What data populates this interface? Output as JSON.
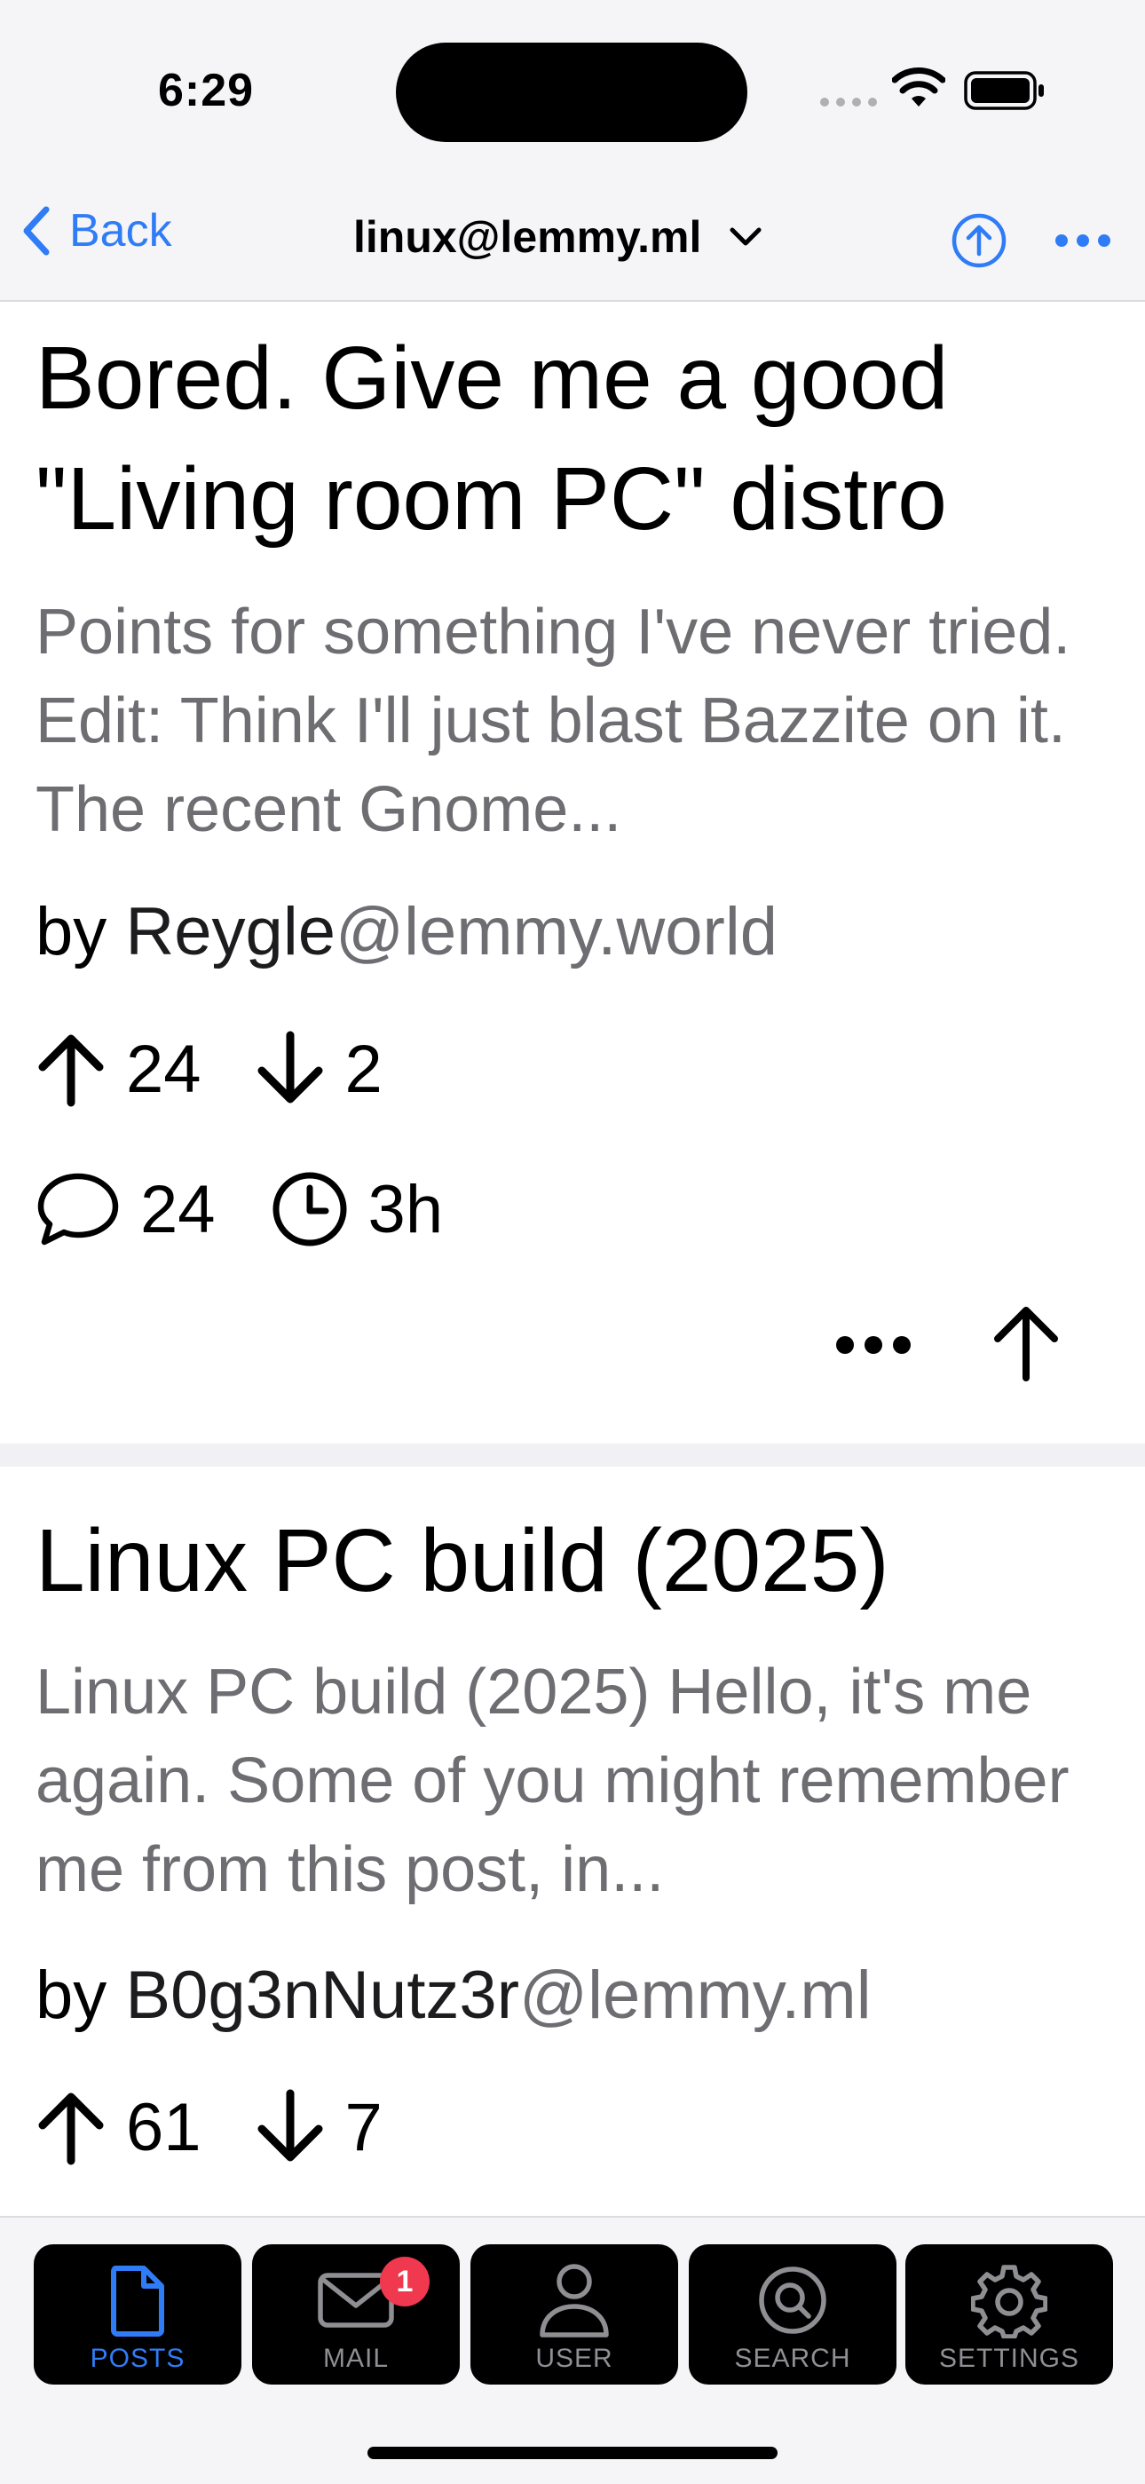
{
  "status": {
    "time": "6:29"
  },
  "nav": {
    "back_label": "Back",
    "title": "linux@lemmy.ml"
  },
  "posts": [
    {
      "title": "Bored. Give me a good \"Living room PC\" distro",
      "body": "Points for something I've never tried. Edit: Think I'll just blast Bazzite on it. The recent Gnome...",
      "by": "by",
      "author": "Reygle",
      "instance": "@lemmy.world",
      "upvotes": "24",
      "downvotes": "2",
      "comments": "24",
      "age": "3h"
    },
    {
      "title": "Linux PC build (2025)",
      "body": "Linux PC build (2025) Hello, it's me again. Some of you might remember me from this post, in...",
      "by": "by",
      "author": "B0g3nNutz3r",
      "instance": "@lemmy.ml",
      "upvotes": "61",
      "downvotes": "7"
    }
  ],
  "tabs": [
    {
      "label": "POSTS",
      "icon": "document-icon",
      "active": true
    },
    {
      "label": "MAIL",
      "icon": "envelope-icon",
      "badge": "1"
    },
    {
      "label": "USER",
      "icon": "person-icon"
    },
    {
      "label": "SEARCH",
      "icon": "search-icon"
    },
    {
      "label": "SETTINGS",
      "icon": "gear-icon"
    }
  ],
  "colors": {
    "accent": "#2f7cf6",
    "badge": "#f0384f",
    "secondary_text": "#6d6d72",
    "tab_inactive": "#8e8e93"
  }
}
